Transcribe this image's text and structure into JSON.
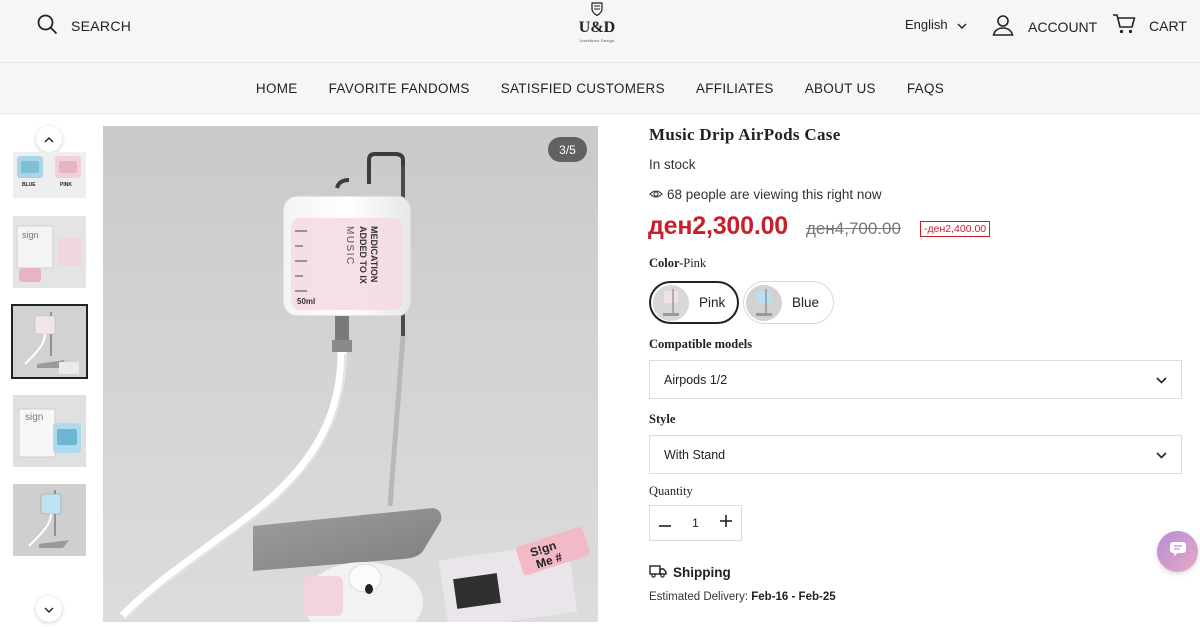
{
  "header": {
    "search_label": "SEARCH",
    "logo_text": "U&D",
    "logo_tagline": "Undefined Design",
    "language": "English",
    "account_label": "ACCOUNT",
    "cart_label": "CART"
  },
  "nav": {
    "items": [
      "HOME",
      "FAVORITE FANDOMS",
      "SATISFIED CUSTOMERS",
      "AFFILIATES",
      "ABOUT US",
      "FAQS"
    ]
  },
  "gallery": {
    "counter": "3/5",
    "thumbnails": [
      {
        "caption_left": "BLUE",
        "caption_right": "PINK"
      },
      {
        "text": "sign"
      },
      {
        "text": ""
      },
      {
        "text": "sign"
      },
      {
        "text": ""
      }
    ],
    "active_index": 2,
    "photo_texts": {
      "bag_line1": "MEDICATION",
      "bag_line2": "ADDED TO IX",
      "bag_line3": "MUSIC",
      "bag_volume": "50ml",
      "tag_text_1": "S!gn",
      "tag_text_2": "Me #"
    }
  },
  "product": {
    "title": "Music Drip AirPods Case",
    "stock": "In stock",
    "viewers": "68 people are viewing this right now",
    "price": "ден2,300.00",
    "compare_price": "ден4,700.00",
    "discount": "-ден2,400.00",
    "color_label": "Color-",
    "color_value": "Pink",
    "colors": [
      "Pink",
      "Blue"
    ],
    "models_label": "Compatible models",
    "models_value": "Airpods 1/2",
    "style_label": "Style",
    "style_value": "With Stand",
    "quantity_label": "Quantity",
    "quantity_value": "1",
    "shipping_label": "Shipping",
    "delivery_label": "Estimated Delivery:",
    "delivery_value": "Feb-16 - Feb-25"
  },
  "colors": {
    "price_red": "#c8202b",
    "chat_gradient_start": "#b58cd6",
    "chat_gradient_end": "#e7a9c3"
  }
}
